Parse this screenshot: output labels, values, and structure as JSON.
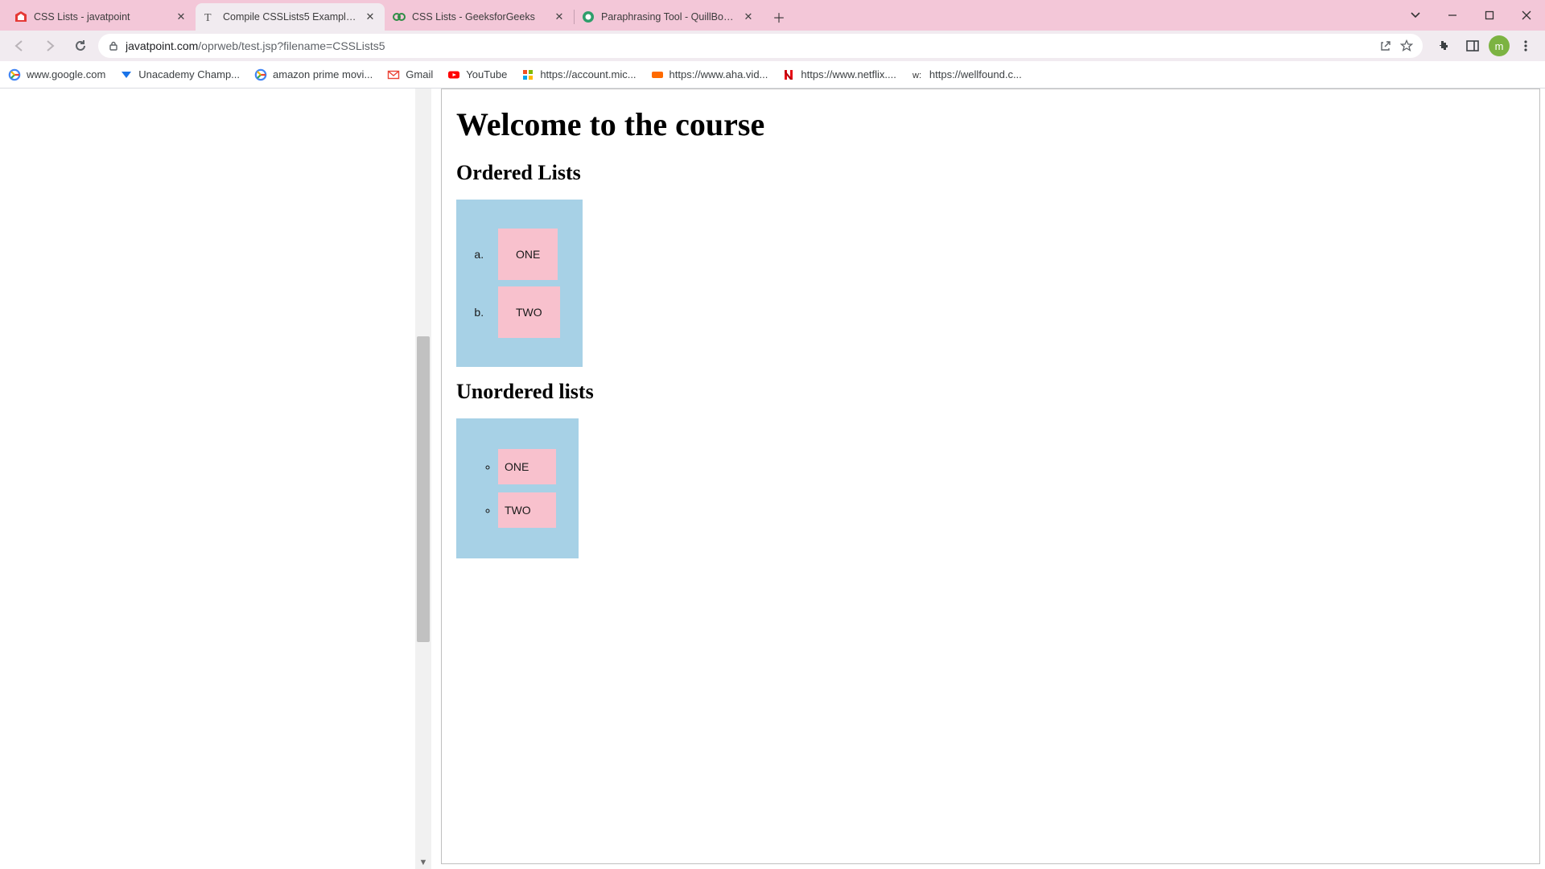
{
  "tabs": [
    {
      "title": "CSS Lists - javatpoint",
      "favicon": "javatpoint",
      "active": false
    },
    {
      "title": "Compile CSSLists5 Example: Edit",
      "favicon": "text",
      "active": true
    },
    {
      "title": "CSS Lists - GeeksforGeeks",
      "favicon": "gfg",
      "active": false
    },
    {
      "title": "Paraphrasing Tool - QuillBot AI",
      "favicon": "quillbot",
      "active": false
    }
  ],
  "address": {
    "host": "javatpoint.com",
    "path": "/oprweb/test.jsp?filename=CSSLists5"
  },
  "avatar_letter": "m",
  "bookmarks": [
    {
      "label": "www.google.com",
      "icon": "google"
    },
    {
      "label": "Unacademy Champ...",
      "icon": "unacademy"
    },
    {
      "label": "amazon prime movi...",
      "icon": "google"
    },
    {
      "label": "Gmail",
      "icon": "gmail"
    },
    {
      "label": "YouTube",
      "icon": "youtube"
    },
    {
      "label": "https://account.mic...",
      "icon": "microsoft"
    },
    {
      "label": "https://www.aha.vid...",
      "icon": "aha"
    },
    {
      "label": "https://www.netflix....",
      "icon": "netflix"
    },
    {
      "label": "https://wellfound.c...",
      "icon": "wellfound"
    }
  ],
  "page": {
    "h1": "Welcome to the course",
    "h2_ordered": "Ordered Lists",
    "h2_unordered": "Unordered lists",
    "ordered_items": [
      "ONE",
      "TWO"
    ],
    "unordered_items": [
      "ONE",
      "TWO"
    ]
  }
}
